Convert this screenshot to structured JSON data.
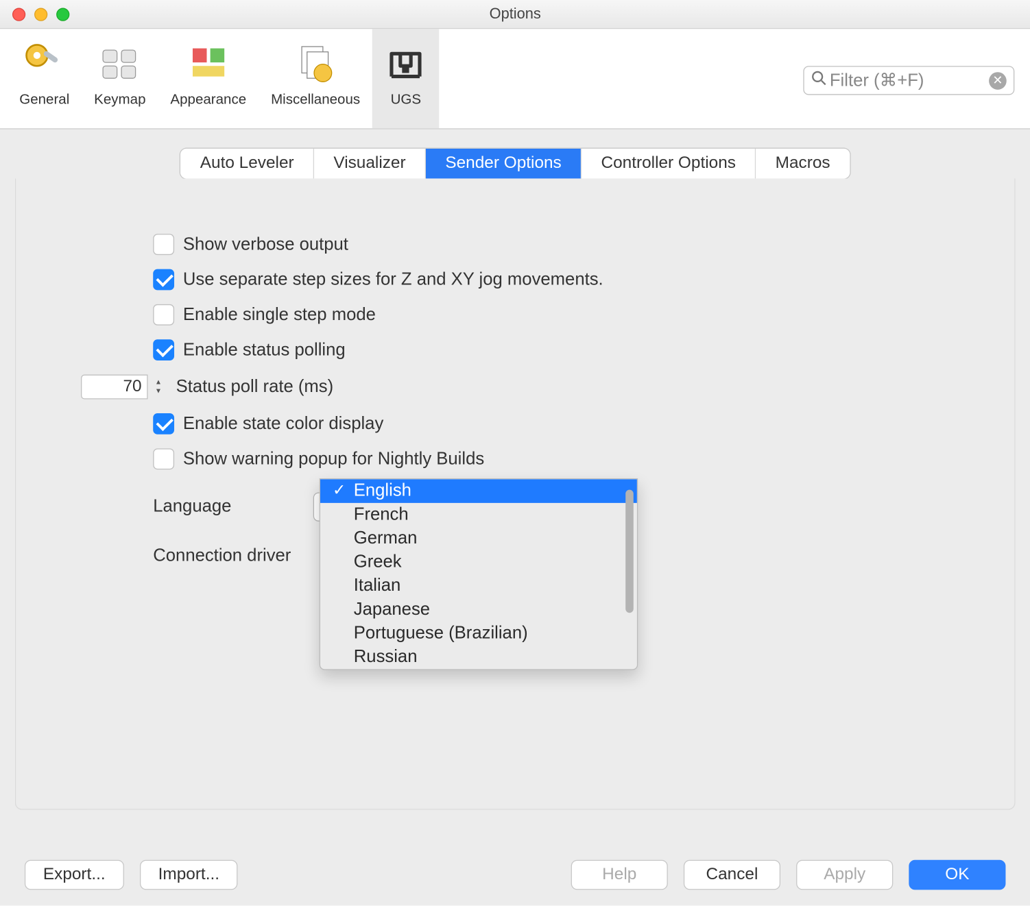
{
  "window": {
    "title": "Options"
  },
  "filter": {
    "placeholder": "Filter (⌘+F)"
  },
  "toolbar": {
    "items": [
      {
        "label": "General"
      },
      {
        "label": "Keymap"
      },
      {
        "label": "Appearance"
      },
      {
        "label": "Miscellaneous"
      },
      {
        "label": "UGS"
      }
    ]
  },
  "tabs": {
    "items": [
      {
        "label": "Auto Leveler"
      },
      {
        "label": "Visualizer"
      },
      {
        "label": "Sender Options"
      },
      {
        "label": "Controller Options"
      },
      {
        "label": "Macros"
      }
    ]
  },
  "sender": {
    "show_verbose": "Show verbose output",
    "separate_step": "Use separate step sizes for Z and XY jog movements.",
    "single_step": "Enable single step mode",
    "status_polling": "Enable status polling",
    "poll_rate_value": "70",
    "poll_rate_label": "Status poll rate (ms)",
    "state_color": "Enable state color display",
    "nightly_warning": "Show warning popup for Nightly Builds",
    "language_label": "Language",
    "language_selected": "English",
    "conn_driver_label": "Connection driver",
    "language_options": [
      "English",
      "French",
      "German",
      "Greek",
      "Italian",
      "Japanese",
      "Portuguese (Brazilian)",
      "Russian"
    ]
  },
  "footer": {
    "export": "Export...",
    "import": "Import...",
    "help": "Help",
    "cancel": "Cancel",
    "apply": "Apply",
    "ok": "OK"
  }
}
